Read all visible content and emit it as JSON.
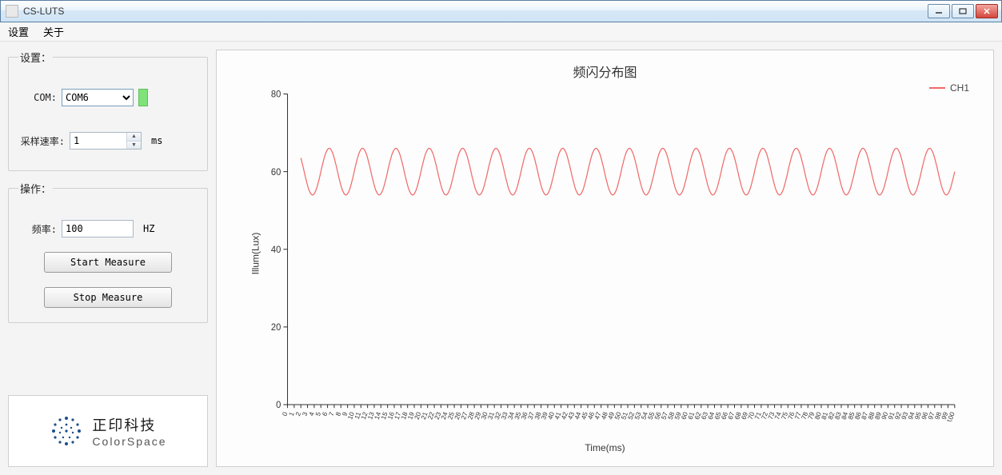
{
  "window": {
    "title": "CS-LUTS"
  },
  "menu": {
    "settings": "设置",
    "about": "关于"
  },
  "settings_group": {
    "legend": "设置：",
    "com_label": "COM:",
    "com_value": "COM6",
    "rate_label": "采样速率:",
    "rate_value": "1",
    "rate_unit": "ms"
  },
  "operation_group": {
    "legend": "操作：",
    "freq_label": "频率:",
    "freq_value": "100",
    "freq_unit": "HZ",
    "start_button": "Start Measure",
    "stop_button": "Stop Measure"
  },
  "logo": {
    "cn": "正印科技",
    "en": "ColorSpace"
  },
  "chart_data": {
    "type": "line",
    "title": "频闪分布图",
    "xlabel": "Time(ms)",
    "ylabel": "Illum(Lux)",
    "ylim": [
      0,
      80
    ],
    "yticks": [
      0,
      20,
      40,
      60,
      80
    ],
    "xlim": [
      0,
      100
    ],
    "xtick_step": 1,
    "series": [
      {
        "name": "CH1",
        "color": "#f06a6a",
        "frequency_hz": 200,
        "amplitude": 6,
        "offset": 60,
        "x_min": 2,
        "x_max": 100
      }
    ]
  }
}
